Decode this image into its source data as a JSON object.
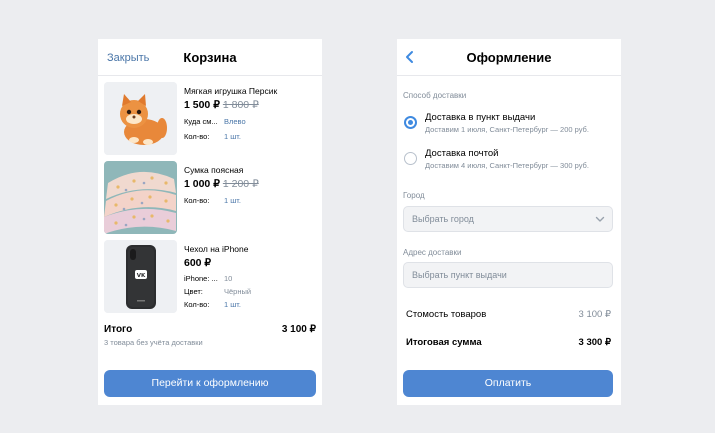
{
  "cart": {
    "close_label": "Закрыть",
    "title": "Корзина",
    "items": [
      {
        "name": "Мягкая игрушка Персик",
        "price": "1 500 ₽",
        "old_price": "1 800 ₽",
        "props": [
          {
            "key": "Куда см...",
            "value": "Влево"
          },
          {
            "key": "Кол-во:",
            "value": "1 шт."
          }
        ]
      },
      {
        "name": "Сумка поясная",
        "price": "1 000 ₽",
        "old_price": "1 200 ₽",
        "props": [
          {
            "key": "Кол-во:",
            "value": "1 шт."
          }
        ]
      },
      {
        "name": "Чехол на iPhone",
        "price": "600 ₽",
        "old_price": "",
        "props": [
          {
            "key": "iPhone: ...",
            "value": "10"
          },
          {
            "key": "Цвет:",
            "value": "Чёрный"
          },
          {
            "key": "Кол-во:",
            "value": "1 шт."
          }
        ]
      }
    ],
    "total_label": "Итого",
    "total_value": "3 100 ₽",
    "total_note": "3 товара без учёта доставки",
    "checkout_button": "Перейти к оформлению"
  },
  "checkout": {
    "title": "Оформление",
    "delivery_label": "Способ доставки",
    "options": [
      {
        "title": "Доставка в пункт выдачи",
        "subtitle": "Доставим 1 июля, Санкт-Петербург — 200 руб.",
        "selected": true
      },
      {
        "title": "Доставка почтой",
        "subtitle": "Доставим 4 июля, Санкт-Петербург — 300 руб.",
        "selected": false
      }
    ],
    "city_label": "Город",
    "city_placeholder": "Выбрать город",
    "address_label": "Адрес доставки",
    "address_placeholder": "Выбрать пункт выдачи",
    "goods_cost_label": "Стомость товаров",
    "goods_cost_value": "3 100 ₽",
    "total_label": "Итоговая сумма",
    "total_value": "3 300 ₽",
    "pay_button": "Оплатить"
  },
  "colors": {
    "accent": "#4e86d2",
    "link": "#4a76a8",
    "background": "#ecedf0"
  }
}
